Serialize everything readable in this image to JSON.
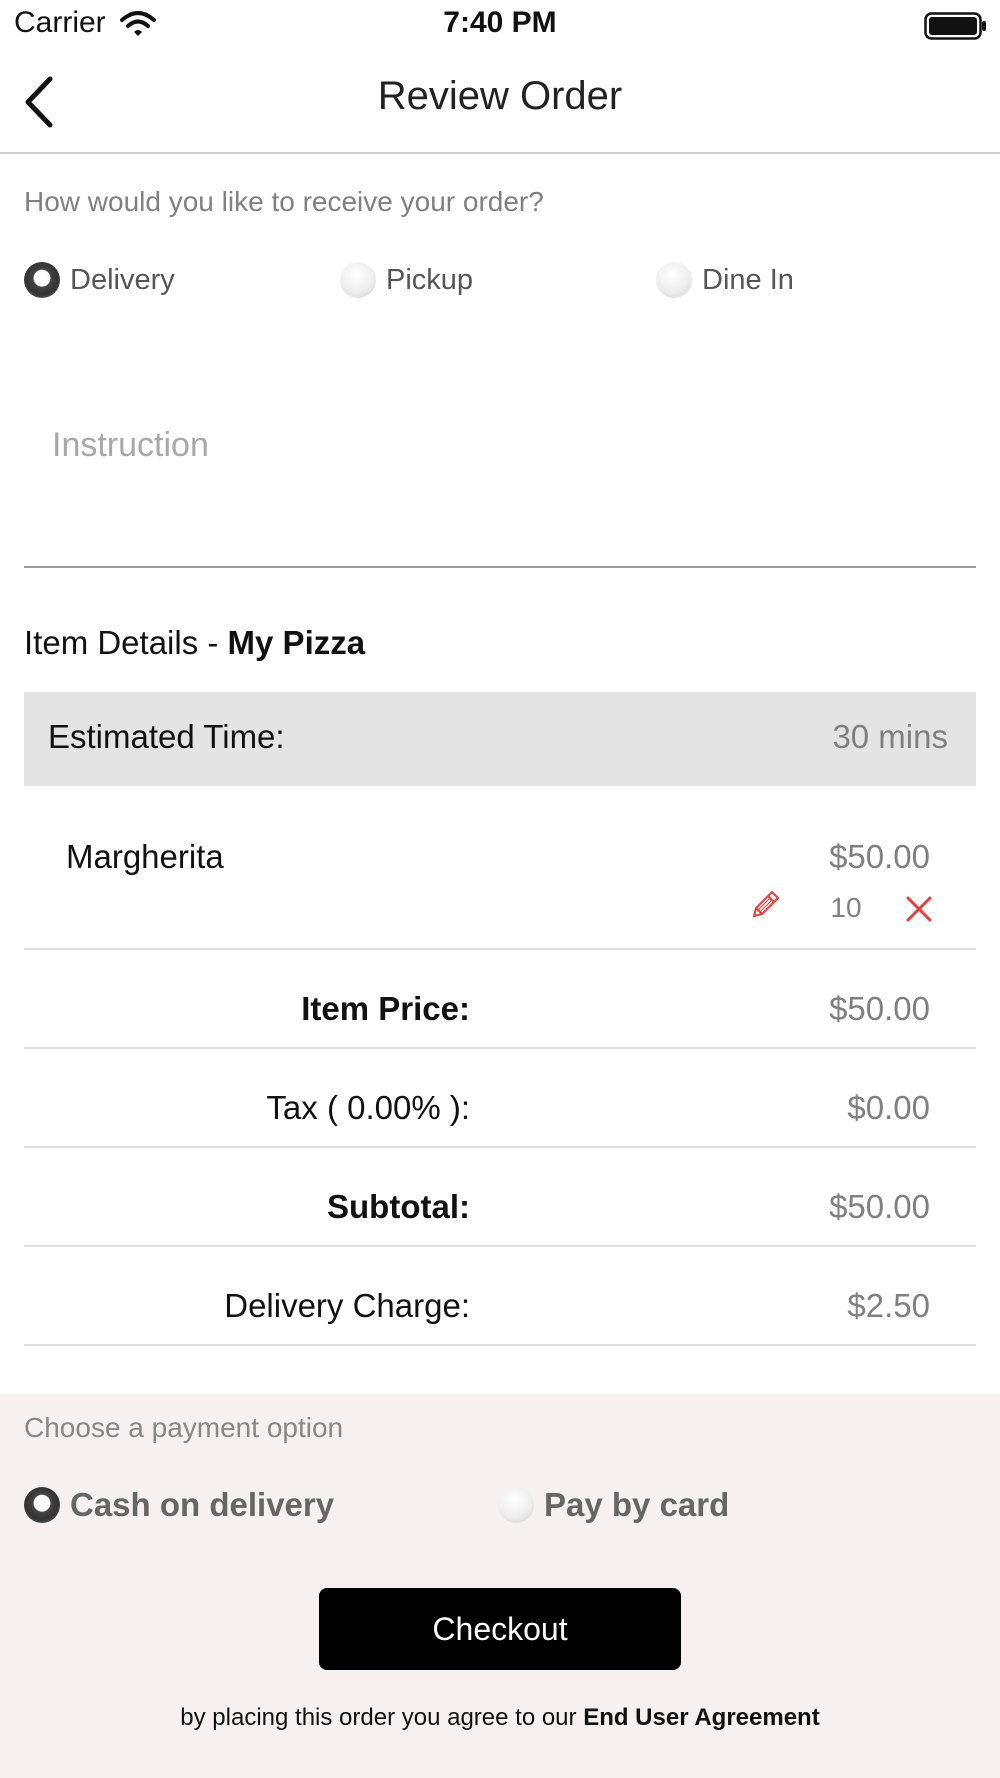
{
  "status_bar": {
    "carrier": "Carrier",
    "time": "7:40 PM"
  },
  "nav": {
    "title": "Review Order",
    "back_icon": "chevron-left-icon"
  },
  "receive": {
    "question": "How would you like to receive your order?",
    "options": [
      {
        "label": "Delivery",
        "selected": true
      },
      {
        "label": "Pickup",
        "selected": false
      },
      {
        "label": "Dine In",
        "selected": false
      }
    ]
  },
  "instruction": {
    "placeholder": "Instruction",
    "value": ""
  },
  "item_details": {
    "prefix": "Item Details - ",
    "store": "My Pizza"
  },
  "estimated": {
    "label": "Estimated Time:",
    "value": "30 mins"
  },
  "items": [
    {
      "name": "Margherita",
      "price": "$50.00",
      "quantity": "10"
    }
  ],
  "summary": [
    {
      "label": "Item Price:",
      "value": "$50.00",
      "bold": true
    },
    {
      "label": "Tax ( 0.00% ):",
      "value": "$0.00",
      "bold": false
    },
    {
      "label": "Subtotal:",
      "value": "$50.00",
      "bold": true
    },
    {
      "label": "Delivery Charge:",
      "value": "$2.50",
      "bold": false
    }
  ],
  "payment": {
    "label": "Choose a payment option",
    "options": [
      {
        "label": "Cash on delivery",
        "selected": true
      },
      {
        "label": "Pay by card",
        "selected": false
      }
    ]
  },
  "checkout": {
    "label": "Checkout"
  },
  "agreement": {
    "text": "by placing this order you agree to our ",
    "link": "End User Agreement"
  },
  "colors": {
    "accent_red": "#e0403a",
    "checkout_bg": "#000000",
    "bottom_bg": "#f6f0f0"
  }
}
